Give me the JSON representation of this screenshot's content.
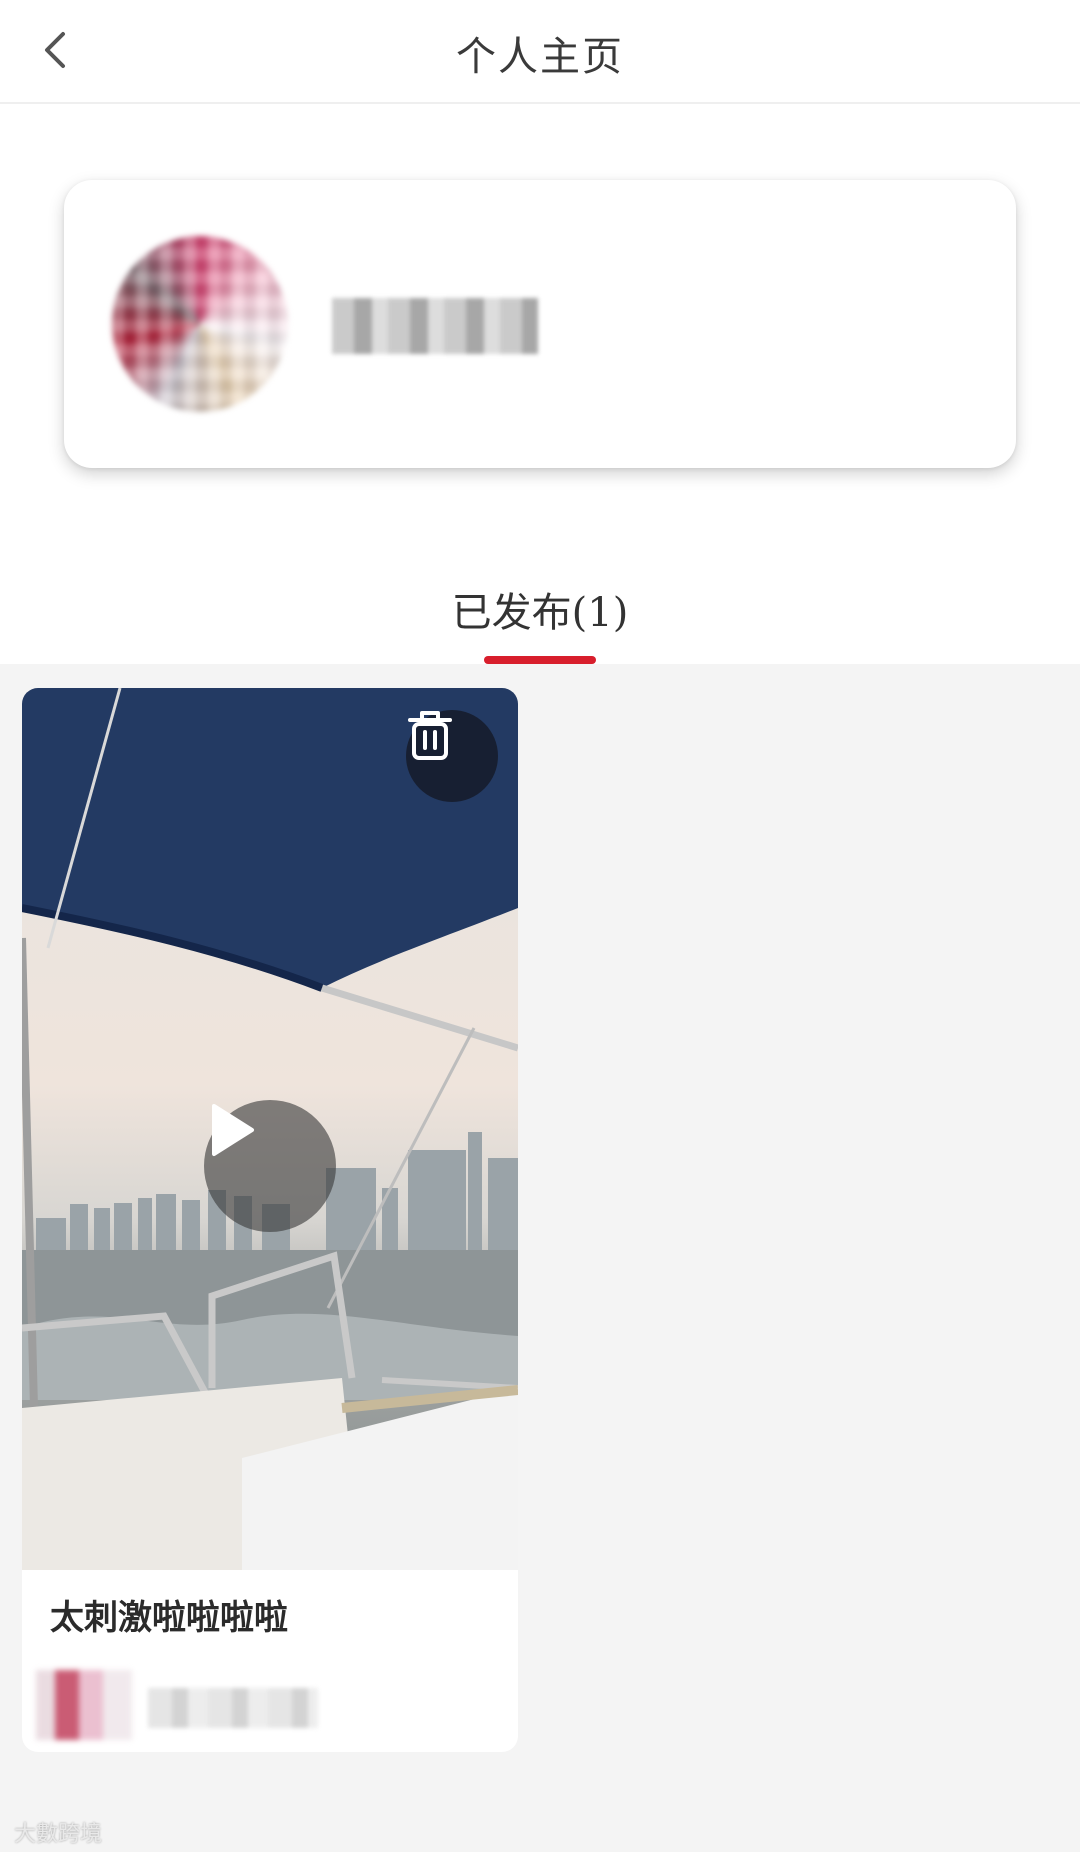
{
  "header": {
    "title": "个人主页",
    "back_icon": "chevron-left-icon"
  },
  "profile": {
    "avatar": "blurred-avatar",
    "username_hidden": true
  },
  "tabs": [
    {
      "label": "已发布(1)",
      "active": true
    }
  ],
  "colors": {
    "accent": "#d81e2c",
    "content_background": "#f4f4f4"
  },
  "posts": [
    {
      "title": "太刺激啦啦啦啦",
      "media_type": "video",
      "delete_icon": "trash-icon",
      "play_icon": "play-icon"
    }
  ],
  "watermark": "大數跨境"
}
